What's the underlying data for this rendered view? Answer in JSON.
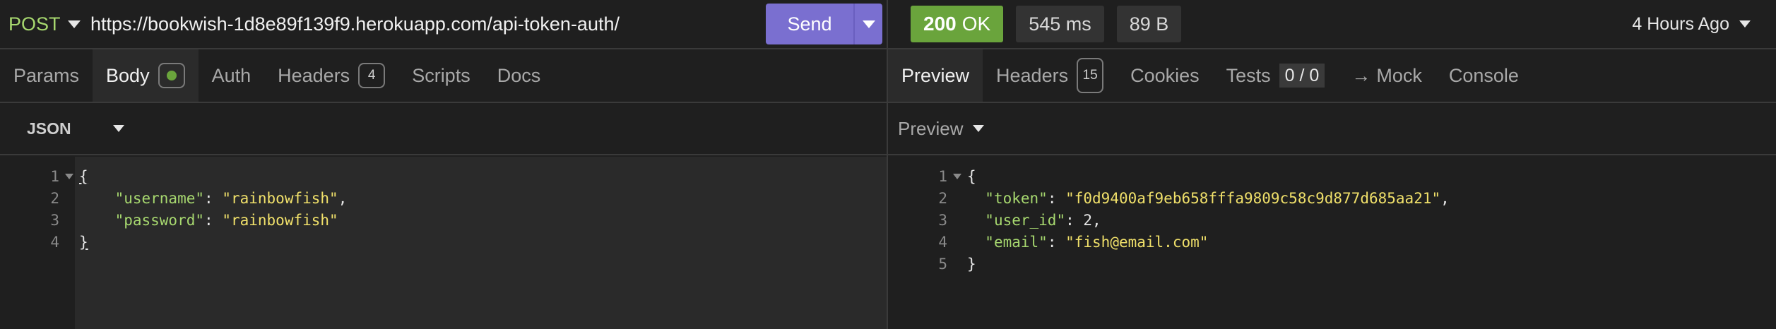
{
  "request": {
    "method": "POST",
    "url": "https://bookwish-1d8e89f139f9.herokuapp.com/api-token-auth/",
    "send_label": "Send"
  },
  "request_tabs": {
    "params": "Params",
    "body": "Body",
    "auth": "Auth",
    "headers": "Headers",
    "headers_count": "4",
    "scripts": "Scripts",
    "docs": "Docs"
  },
  "body_format": "JSON",
  "request_body": {
    "line_numbers": [
      "1",
      "2",
      "3",
      "4"
    ],
    "open_brace": "{",
    "close_brace": "}",
    "username_key": "\"username\"",
    "username_value": "\"rainbowfish\"",
    "password_key": "\"password\"",
    "password_value": "\"rainbowfish\""
  },
  "response": {
    "status_code": "200",
    "status_text": "OK",
    "time": "545 ms",
    "size": "89 B",
    "ago": "4 Hours Ago"
  },
  "response_tabs": {
    "preview": "Preview",
    "headers": "Headers",
    "headers_count": "15",
    "cookies": "Cookies",
    "tests": "Tests",
    "tests_count": "0 / 0",
    "mock": "Mock",
    "console": "Console"
  },
  "preview_label": "Preview",
  "response_body": {
    "line_numbers": [
      "1",
      "2",
      "3",
      "4",
      "5"
    ],
    "open_brace": "{",
    "close_brace": "}",
    "token_key": "\"token\"",
    "token_value": "\"f0d9400af9eb658fffa9809c58c9d877d685aa21\"",
    "user_id_key": "\"user_id\"",
    "user_id_value": "2",
    "email_key": "\"email\"",
    "email_value": "\"fish@email.com\""
  },
  "colors": {
    "method": "#a7d86f",
    "send": "#7a6fd0",
    "status_ok": "#6aa43c",
    "json_key": "#a7d86f",
    "json_string": "#f0e06a"
  },
  "icons": [
    "chevron-down-icon",
    "status-dot-icon",
    "arrow-right-icon",
    "fold-caret-icon"
  ]
}
